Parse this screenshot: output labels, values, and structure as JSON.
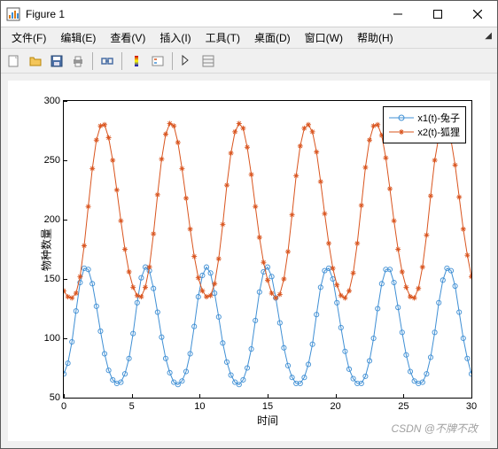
{
  "window": {
    "title": "Figure 1"
  },
  "menu": {
    "file": "文件(F)",
    "edit": "编辑(E)",
    "view": "查看(V)",
    "insert": "插入(I)",
    "tools": "工具(T)",
    "desktop": "桌面(D)",
    "window": "窗口(W)",
    "help": "帮助(H)"
  },
  "axis": {
    "xlabel": "时间",
    "ylabel": "物种数量"
  },
  "legend": {
    "s1": "x1(t)-兔子",
    "s2": "x2(t)-狐狸"
  },
  "watermark": "CSDN @不牌不改",
  "colors": {
    "s1": "#3f8fd4",
    "s2": "#d9541e"
  },
  "chart_data": {
    "type": "line",
    "xlabel": "时间",
    "ylabel": "物种数量",
    "xlim": [
      0,
      30
    ],
    "ylim": [
      50,
      300
    ],
    "xticks": [
      0,
      5,
      10,
      15,
      20,
      25,
      30
    ],
    "yticks": [
      50,
      100,
      150,
      200,
      250,
      300
    ],
    "series": [
      {
        "name": "x1(t)-兔子",
        "color": "#3f8fd4",
        "marker": "circle",
        "x": [
          0,
          0.3,
          0.6,
          0.9,
          1.2,
          1.5,
          1.8,
          2.1,
          2.4,
          2.7,
          3,
          3.3,
          3.6,
          3.9,
          4.2,
          4.5,
          4.8,
          5.1,
          5.4,
          5.7,
          6,
          6.3,
          6.6,
          6.9,
          7.2,
          7.5,
          7.8,
          8.1,
          8.4,
          8.7,
          9,
          9.3,
          9.6,
          9.9,
          10.2,
          10.5,
          10.8,
          11.1,
          11.4,
          11.7,
          12,
          12.3,
          12.6,
          12.9,
          13.2,
          13.5,
          13.8,
          14.1,
          14.4,
          14.7,
          15,
          15.3,
          15.6,
          15.9,
          16.2,
          16.5,
          16.8,
          17.1,
          17.4,
          17.7,
          18,
          18.3,
          18.6,
          18.9,
          19.2,
          19.5,
          19.8,
          20.1,
          20.4,
          20.7,
          21,
          21.3,
          21.6,
          21.9,
          22.2,
          22.5,
          22.8,
          23.1,
          23.4,
          23.7,
          24,
          24.3,
          24.6,
          24.9,
          25.2,
          25.5,
          25.8,
          26.1,
          26.4,
          26.7,
          27,
          27.3,
          27.6,
          27.9,
          28.2,
          28.5,
          28.8,
          29.1,
          29.4,
          29.7,
          30
        ],
        "y": [
          70,
          79,
          97,
          123,
          147,
          159,
          158,
          146,
          127,
          106,
          87,
          73,
          65,
          62,
          63,
          70,
          83,
          104,
          130,
          151,
          160,
          157,
          142,
          122,
          101,
          83,
          71,
          63,
          61,
          64,
          72,
          87,
          110,
          135,
          153,
          160,
          155,
          138,
          118,
          96,
          80,
          69,
          63,
          61,
          65,
          75,
          91,
          115,
          139,
          156,
          160,
          152,
          134,
          113,
          92,
          77,
          67,
          62,
          62,
          67,
          78,
          95,
          120,
          143,
          157,
          159,
          150,
          130,
          109,
          89,
          74,
          66,
          62,
          62,
          68,
          81,
          100,
          125,
          146,
          158,
          158,
          147,
          126,
          105,
          86,
          72,
          64,
          62,
          63,
          70,
          84,
          105,
          130,
          149,
          159,
          157,
          144,
          122,
          100,
          83,
          70
        ]
      },
      {
        "name": "x2(t)-狐狸",
        "color": "#d9541e",
        "marker": "star",
        "x": [
          0,
          0.3,
          0.6,
          0.9,
          1.2,
          1.5,
          1.8,
          2.1,
          2.4,
          2.7,
          3,
          3.3,
          3.6,
          3.9,
          4.2,
          4.5,
          4.8,
          5.1,
          5.4,
          5.7,
          6,
          6.3,
          6.6,
          6.9,
          7.2,
          7.5,
          7.8,
          8.1,
          8.4,
          8.7,
          9,
          9.3,
          9.6,
          9.9,
          10.2,
          10.5,
          10.8,
          11.1,
          11.4,
          11.7,
          12,
          12.3,
          12.6,
          12.9,
          13.2,
          13.5,
          13.8,
          14.1,
          14.4,
          14.7,
          15,
          15.3,
          15.6,
          15.9,
          16.2,
          16.5,
          16.8,
          17.1,
          17.4,
          17.7,
          18,
          18.3,
          18.6,
          18.9,
          19.2,
          19.5,
          19.8,
          20.1,
          20.4,
          20.7,
          21,
          21.3,
          21.6,
          21.9,
          22.2,
          22.5,
          22.8,
          23.1,
          23.4,
          23.7,
          24,
          24.3,
          24.6,
          24.9,
          25.2,
          25.5,
          25.8,
          26.1,
          26.4,
          26.7,
          27,
          27.3,
          27.6,
          27.9,
          28.2,
          28.5,
          28.8,
          29.1,
          29.4,
          29.7,
          30
        ],
        "y": [
          140,
          135,
          134,
          138,
          152,
          178,
          211,
          243,
          267,
          279,
          280,
          269,
          250,
          225,
          199,
          175,
          156,
          143,
          136,
          135,
          143,
          160,
          188,
          221,
          251,
          272,
          281,
          279,
          265,
          243,
          218,
          192,
          169,
          151,
          140,
          135,
          136,
          146,
          167,
          196,
          229,
          256,
          274,
          281,
          277,
          261,
          238,
          211,
          185,
          164,
          149,
          138,
          134,
          137,
          150,
          173,
          204,
          237,
          262,
          277,
          280,
          274,
          257,
          232,
          205,
          180,
          159,
          145,
          136,
          134,
          140,
          155,
          180,
          212,
          244,
          267,
          279,
          280,
          271,
          252,
          226,
          199,
          175,
          156,
          143,
          135,
          134,
          142,
          160,
          187,
          220,
          250,
          270,
          280,
          279,
          267,
          246,
          219,
          192,
          170,
          152
        ]
      }
    ]
  }
}
